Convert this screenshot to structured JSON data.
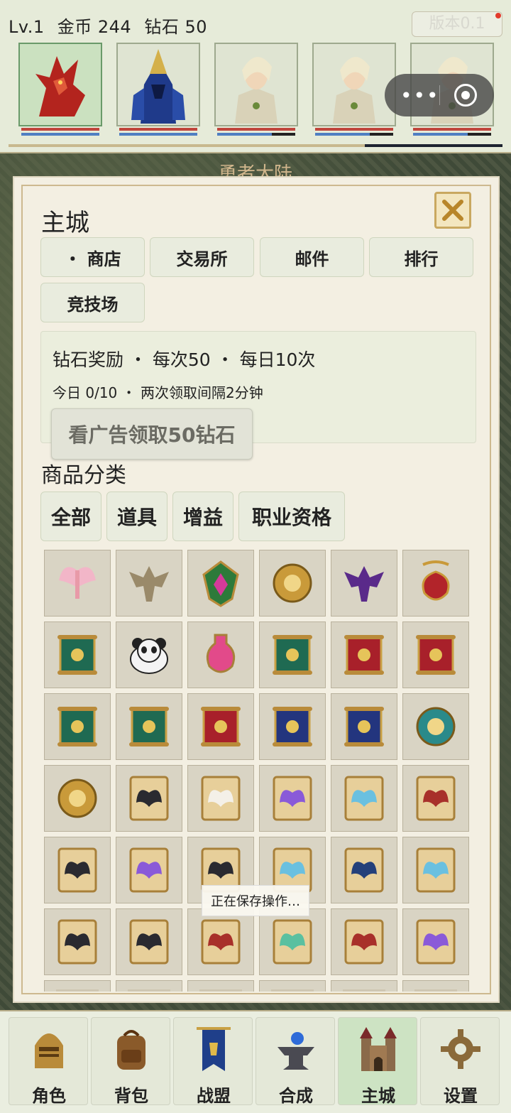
{
  "header": {
    "level": "Lv.1",
    "gold": "金币 244",
    "diamond": "钻石 50",
    "version": "版本0.1"
  },
  "heroes": [
    {
      "name": "red-dragon-portrait",
      "selected": true,
      "mp_lost_fraction": 0
    },
    {
      "name": "blue-knight-portrait",
      "selected": false,
      "mp_lost_fraction": 0
    },
    {
      "name": "elf-archer-portrait",
      "selected": false,
      "mp_lost_fraction": 0.3
    },
    {
      "name": "elf-archer-portrait",
      "selected": false,
      "mp_lost_fraction": 0.3
    },
    {
      "name": "elf-archer-portrait",
      "selected": false,
      "mp_lost_fraction": 0.3
    }
  ],
  "xp_fraction": 0.72,
  "map_label": "勇者大陆",
  "panel": {
    "title": "主城",
    "tabs": [
      "・ 商店",
      "交易所",
      "邮件",
      "排行",
      "竞技场"
    ],
    "reward": {
      "title": "钻石奖励 ・ 每次50 ・ 每日10次",
      "subtitle": "今日 0/10 ・ 两次领取间隔2分钟",
      "ad_button": "看广告领取50钻石"
    },
    "category_label": "商品分类",
    "categories": [
      "全部",
      "道具",
      "增益",
      "职业资格"
    ],
    "items": [
      "fairy-wings-icon",
      "bone-dragon-icon",
      "emerald-crest-icon",
      "fist-medal-icon",
      "bat-demon-icon",
      "clover-amulet-icon",
      "tree-scroll-icon",
      "panda-icon",
      "heart-potion-icon",
      "swords-scroll-icon",
      "shield-scroll-icon",
      "crown-scroll-icon",
      "heart-scroll-icon",
      "sun-scroll-icon",
      "cross-scroll-icon",
      "hand-scroll-icon",
      "arrows-scroll-icon",
      "crystal-seal-icon",
      "sun-seal-icon",
      "hooded-key-card-icon",
      "white-wings-card-icon",
      "violet-wings-card-icon",
      "butterfly-wings-card-icon",
      "bat-wings-card-icon",
      "dark-wings-card-icon",
      "purple-wings-card-icon",
      "black-gold-wings-card-icon",
      "ice-wings-card-icon",
      "blue-cape-card-icon",
      "frost-wings-card-icon",
      "black-cape-card-icon",
      "demon-wings-card-icon",
      "flame-cape-card-icon",
      "fairy-green-wings-card-icon",
      "red-cape-card-icon",
      "lavender-wings-card-icon",
      "partial-item-icon",
      "partial-item-icon",
      "partial-item-icon",
      "partial-item-icon",
      "partial-item-icon",
      "partial-item-icon"
    ]
  },
  "toast": "正在保存操作…",
  "nav": [
    {
      "label": "角色",
      "icon": "helmet-icon",
      "active": false
    },
    {
      "label": "背包",
      "icon": "backpack-icon",
      "active": false
    },
    {
      "label": "战盟",
      "icon": "banner-icon",
      "active": false
    },
    {
      "label": "合成",
      "icon": "anvil-icon",
      "active": false
    },
    {
      "label": "主城",
      "icon": "castle-icon",
      "active": true
    },
    {
      "label": "设置",
      "icon": "gear-icon",
      "active": false
    }
  ],
  "colors": {
    "hp": "#c0453c",
    "mp": "#4f7fc2",
    "accent_gold": "#c9a860",
    "active_green": "#cde3c3"
  }
}
